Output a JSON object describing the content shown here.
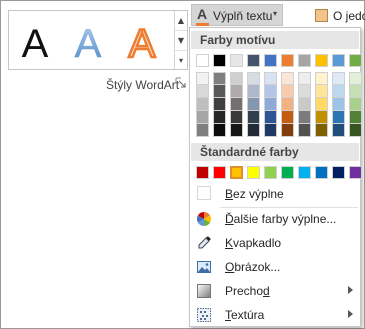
{
  "ribbon": {
    "wordart_styles": [
      {
        "name": "wordart-black",
        "letter": "A"
      },
      {
        "name": "wordart-blue-gradient",
        "letter": "A"
      },
      {
        "name": "wordart-orange-outline",
        "letter": "A"
      }
    ],
    "group_label": "Štýly WordArt",
    "text_fill_button": {
      "icon_letter": "A",
      "label": "Výplň textu",
      "caret": "▾",
      "underline_color": "#ED7D31"
    },
    "text_outline_button": {
      "label": "O jedo"
    },
    "scroll_glyphs": [
      "▲",
      "▼",
      "▾"
    ]
  },
  "menu": {
    "theme_colors_header": "Farby motívu",
    "theme_colors": [
      [
        "#FFFFFF",
        "#000000",
        "#E7E6E6",
        "#44546A",
        "#4472C4",
        "#ED7D31",
        "#A5A5A5",
        "#FFC000",
        "#5B9BD5",
        "#70AD47"
      ],
      [
        "#F2F2F2",
        "#7F7F7F",
        "#D0CECE",
        "#D6DCE4",
        "#D9E2F3",
        "#FBE5D5",
        "#EDEDED",
        "#FFF2CC",
        "#DEEBF6",
        "#E2EFD9"
      ],
      [
        "#D8D8D8",
        "#595959",
        "#AEAAAA",
        "#ADB9CA",
        "#B4C6E7",
        "#F7CBAC",
        "#DBDBDB",
        "#FEE599",
        "#BDD7EE",
        "#C5E0B3"
      ],
      [
        "#BFBFBF",
        "#3F3F3F",
        "#757070",
        "#8496B0",
        "#8EAADB",
        "#F4B183",
        "#C9C9C9",
        "#FFD965",
        "#9DC3E6",
        "#A8D08D"
      ],
      [
        "#A5A5A5",
        "#262626",
        "#3A3838",
        "#323F4F",
        "#2F5496",
        "#C55A11",
        "#7B7B7B",
        "#BF9000",
        "#2E75B5",
        "#538135"
      ],
      [
        "#7F7F7F",
        "#0C0C0C",
        "#171616",
        "#222A35",
        "#1F3864",
        "#833C0B",
        "#525252",
        "#7F6000",
        "#1E4E79",
        "#375623"
      ]
    ],
    "standard_colors_header": "Štandardné farby",
    "standard_colors": [
      "#C00000",
      "#FF0000",
      "#FFC000",
      "#FFFF00",
      "#92D050",
      "#00B050",
      "#00B0F0",
      "#0070C0",
      "#002060",
      "#7030A0"
    ],
    "selected_standard_index": 2,
    "no_fill": {
      "label_pre": "",
      "label_ul": "B",
      "label_post": "ez výplne"
    },
    "more_colors": {
      "label_pre": "",
      "label_ul": "Ď",
      "label_post": "alšie farby výplne...",
      "icon": "color-wheel-icon"
    },
    "eyedropper": {
      "label_pre": "",
      "label_ul": "K",
      "label_post": "vapkadlo",
      "icon": "eyedropper-icon"
    },
    "picture": {
      "label_pre": "",
      "label_ul": "O",
      "label_post": "brázok...",
      "icon": "picture-icon"
    },
    "gradient": {
      "label_pre": "Precho",
      "label_ul": "d",
      "label_post": "",
      "icon": "gradient-icon",
      "has_submenu": true
    },
    "texture": {
      "label_pre": "",
      "label_ul": "T",
      "label_post": "extúra",
      "icon": "texture-icon",
      "has_submenu": true
    }
  }
}
